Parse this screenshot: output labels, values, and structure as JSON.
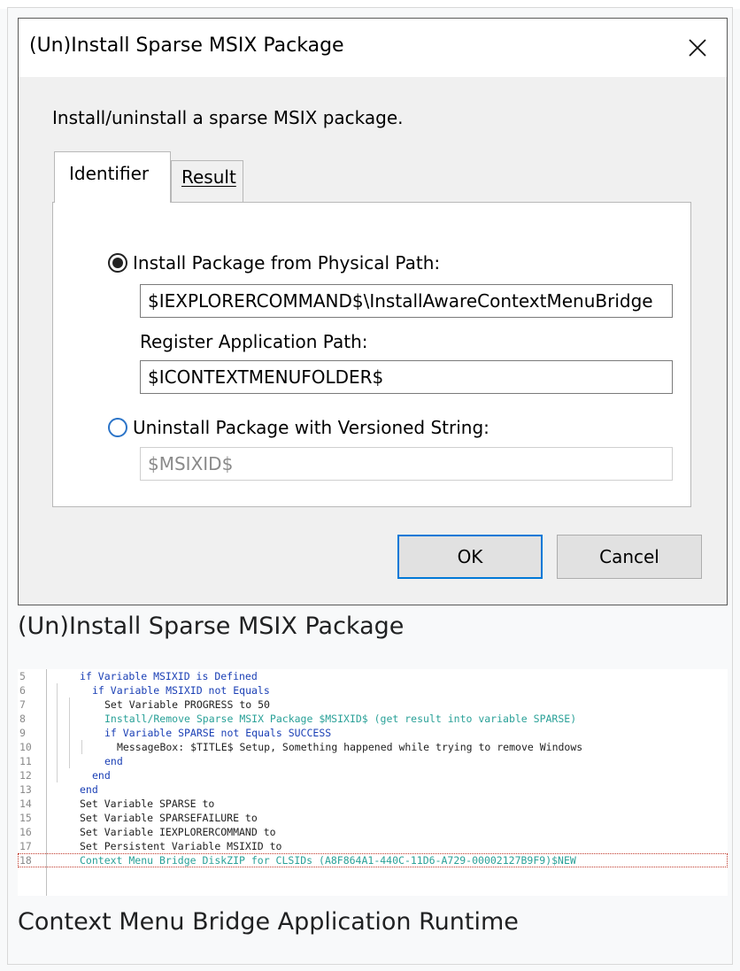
{
  "dialog": {
    "title": "(Un)Install Sparse MSIX Package",
    "description": "Install/uninstall a sparse MSIX package.",
    "tabs": [
      {
        "label": "Identifier",
        "active": true
      },
      {
        "label": "Result",
        "active": false
      }
    ],
    "install_option": {
      "label": "Install Package from Physical Path:",
      "checked": true,
      "value": "$IEXPLORERCOMMAND$\\InstallAwareContextMenuBridge"
    },
    "register": {
      "label": "Register Application Path:",
      "value": "$ICONTEXTMENUFOLDER$"
    },
    "uninstall_option": {
      "label": "Uninstall Package with Versioned String:",
      "checked": false,
      "value": "$MSIXID$"
    },
    "buttons": {
      "ok": "OK",
      "cancel": "Cancel"
    }
  },
  "captions": {
    "dialog": "(Un)Install Sparse MSIX Package",
    "code": "Context Menu Bridge Application Runtime"
  },
  "colors": {
    "keyword": "#1a3fb5",
    "action": "#2aa198",
    "plain": "#222222",
    "ok_border": "#0078d7"
  },
  "code_lines": [
    {
      "n": "5",
      "indent": 3,
      "kind": "keyword",
      "text": "if Variable MSIXID is Defined"
    },
    {
      "n": "6",
      "indent": 4,
      "kind": "keyword",
      "text": "if Variable MSIXID not Equals"
    },
    {
      "n": "7",
      "indent": 5,
      "kind": "plain",
      "text": "Set Variable PROGRESS to 50"
    },
    {
      "n": "8",
      "indent": 5,
      "kind": "action",
      "text": "Install/Remove Sparse MSIX Package $MSIXID$ (get result into variable SPARSE)"
    },
    {
      "n": "9",
      "indent": 5,
      "kind": "keyword",
      "text": "if Variable SPARSE not Equals SUCCESS"
    },
    {
      "n": "10",
      "indent": 6,
      "kind": "plain",
      "text": "MessageBox: $TITLE$ Setup, Something happened while trying to remove Windows"
    },
    {
      "n": "11",
      "indent": 5,
      "kind": "keyword",
      "text": "end"
    },
    {
      "n": "12",
      "indent": 4,
      "kind": "keyword",
      "text": "end"
    },
    {
      "n": "13",
      "indent": 3,
      "kind": "keyword",
      "text": "end"
    },
    {
      "n": "14",
      "indent": 3,
      "kind": "plain",
      "text": "Set Variable SPARSE to"
    },
    {
      "n": "15",
      "indent": 3,
      "kind": "plain",
      "text": "Set Variable SPARSEFAILURE to"
    },
    {
      "n": "16",
      "indent": 3,
      "kind": "plain",
      "text": "Set Variable IEXPLORERCOMMAND to"
    },
    {
      "n": "17",
      "indent": 3,
      "kind": "plain",
      "text": "Set Persistent Variable MSIXID to"
    },
    {
      "n": "18",
      "indent": 3,
      "kind": "action",
      "text": "Context Menu Bridge DiskZIP for CLSIDs (A8F864A1-440C-11D6-A729-00002127B9F9)$NEW",
      "selected": true
    }
  ]
}
